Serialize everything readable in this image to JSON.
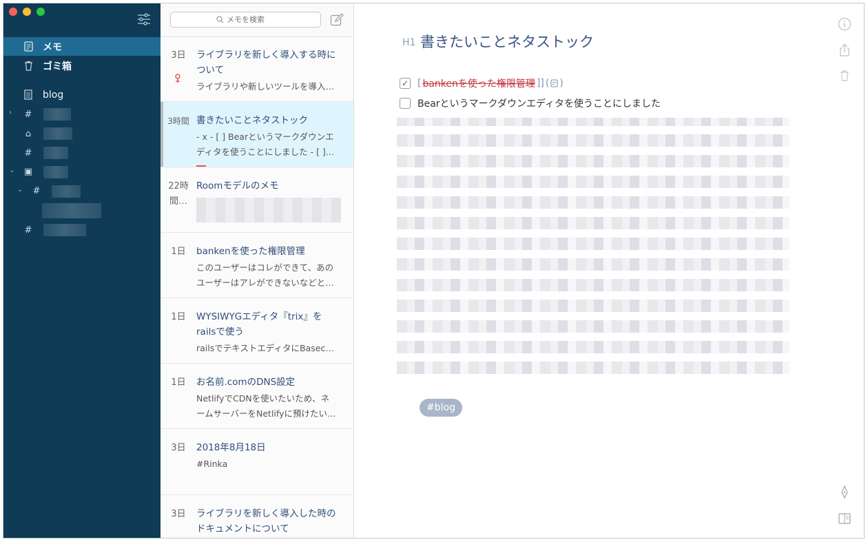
{
  "sidebar": {
    "items": [
      {
        "label": "メモ",
        "icon": "note-icon"
      },
      {
        "label": "ゴミ箱",
        "icon": "trash-icon"
      },
      {
        "label": "blog",
        "icon": "notebook-icon"
      }
    ]
  },
  "search": {
    "placeholder": "メモを検索"
  },
  "notes": [
    {
      "date": "3日",
      "title": "ライブラリを新しく導入する時に\nついて",
      "preview": "ライブラリや新しいツールを導入…"
    },
    {
      "date": "3時間",
      "title": "書きたいことネタストック",
      "preview": "- x - [ ] Bearというマークダウンエ\nディタを使うことにしました - [ ]…"
    },
    {
      "date": "22時\n間…",
      "title": "Roomモデルのメモ",
      "preview": ""
    },
    {
      "date": "1日",
      "title": "bankenを使った権限管理",
      "preview": "このユーザーはコレができて、あの\nユーザーはアレができないなどと…"
    },
    {
      "date": "1日",
      "title": "WYSIWYGエディタ『trix』を\nrailsで使う",
      "preview": "railsでテキストエディタにBasec…"
    },
    {
      "date": "1日",
      "title": "お名前.comのDNS設定",
      "preview": "NetlifyでCDNを使いたいため、ネ\nームサーバーをNetlifyに預けたい…"
    },
    {
      "date": "3日",
      "title": "2018年8月18日",
      "preview": "#Rinka"
    },
    {
      "date": "3日",
      "title": "ライブラリを新しく導入した時の\nドキュメントについて",
      "preview": ""
    }
  ],
  "editor": {
    "heading_marker": "H1",
    "title": "書きたいことネタストック",
    "todos": [
      {
        "checked": true,
        "check_glyph": "✓",
        "bracket_open": "[",
        "text": "bankenを使った権限管理",
        "bracket_close": "]]"
      },
      {
        "checked": false,
        "check_glyph": "",
        "text": "Bearというマークダウンエディタを使うことにしました"
      }
    ],
    "tag": "#blog"
  },
  "colors": {
    "sidebar_bg": "#0f3b56",
    "sidebar_active": "#1f6b93",
    "selected_note_bg": "#dff5fd",
    "title_blue": "#3a5483",
    "tag_bg": "#a8b6c8",
    "strike_red": "#c2323a"
  }
}
